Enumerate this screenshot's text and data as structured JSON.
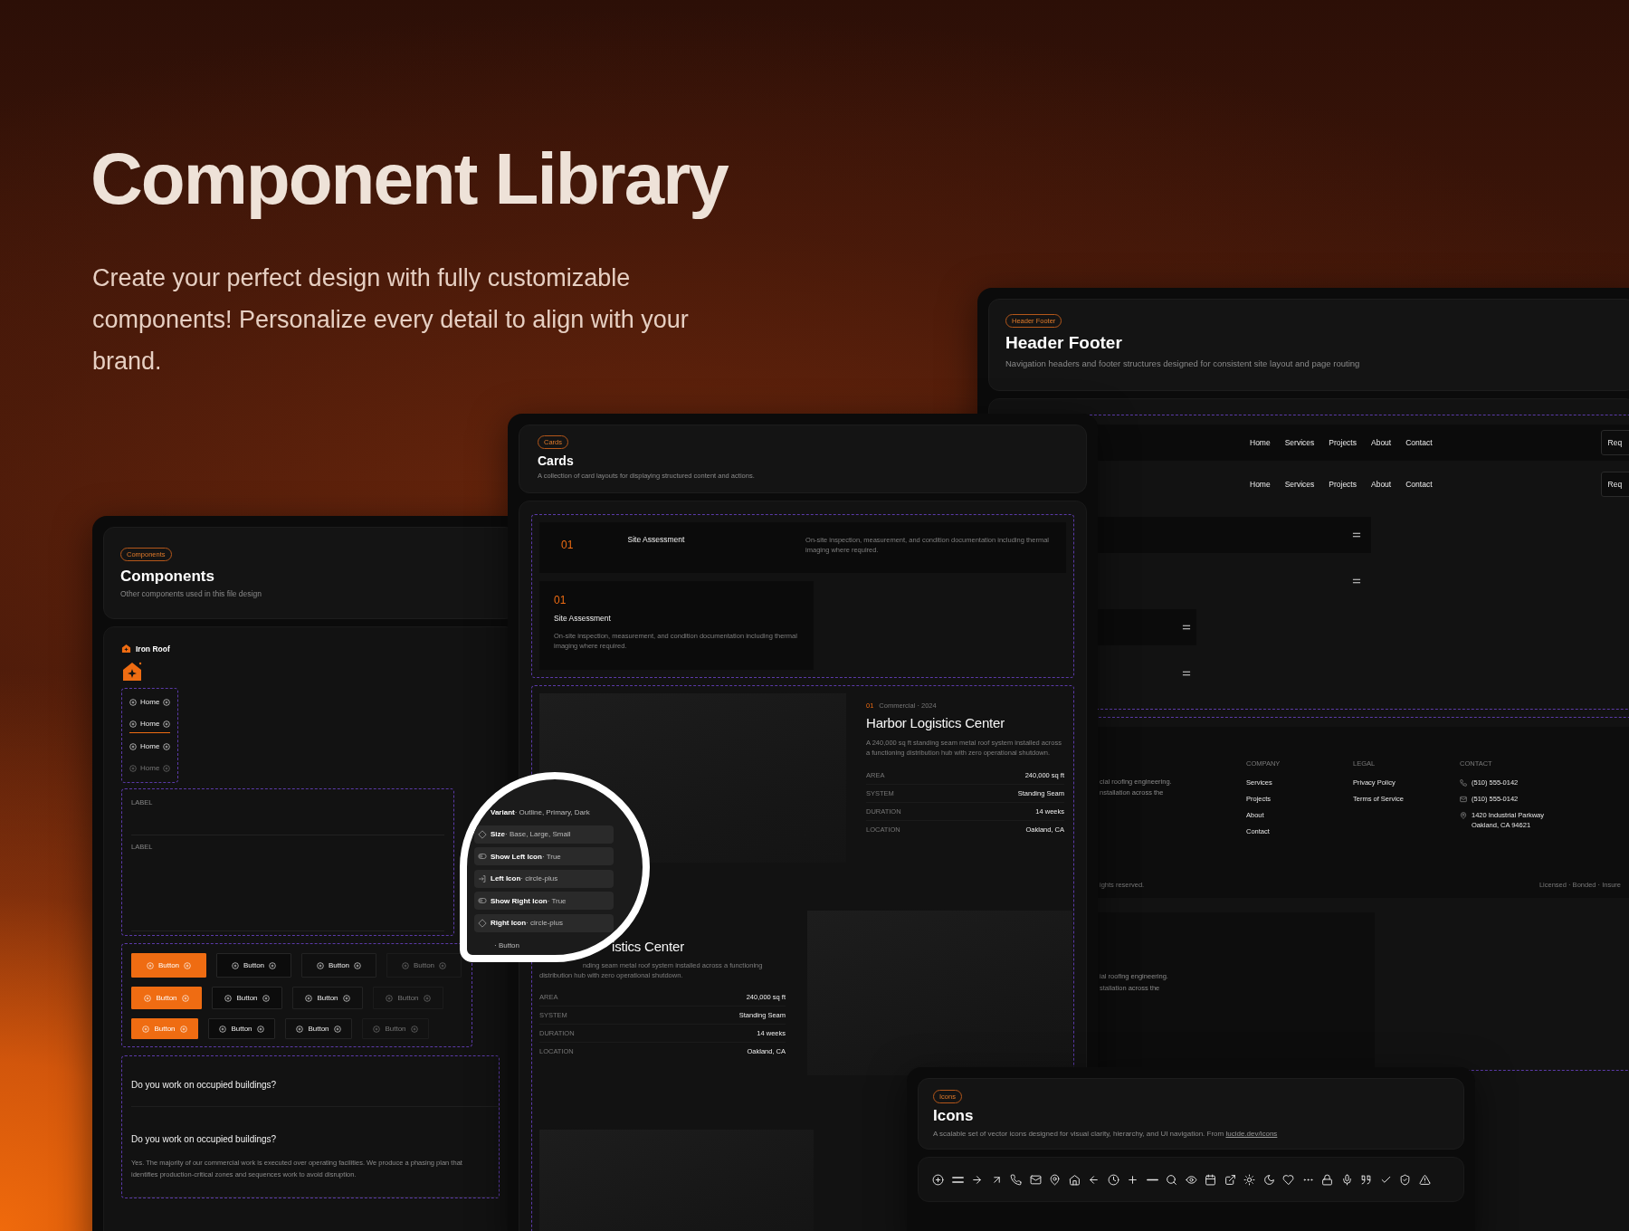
{
  "hero": {
    "title": "Component Library",
    "subtitle": "Create your perfect design with fully customizable components! Personalize every detail to align with your brand."
  },
  "components_panel": {
    "badge": "Components",
    "title": "Components",
    "description": "Other components used in this file design",
    "logo_name": "Iron Roof",
    "nav_items": [
      {
        "label": "Home",
        "selected": false,
        "disabled": false
      },
      {
        "label": "Home",
        "selected": true,
        "disabled": false
      },
      {
        "label": "Home",
        "selected": false,
        "disabled": false
      },
      {
        "label": "Home",
        "selected": false,
        "disabled": true
      }
    ],
    "fields": [
      {
        "label": "LABEL",
        "kind": "input"
      },
      {
        "label": "LABEL",
        "kind": "textarea"
      }
    ],
    "button_rows": [
      {
        "kind": "large",
        "buttons": [
          {
            "label": "Button",
            "kind": "primary"
          },
          {
            "label": "Button",
            "kind": "outline"
          },
          {
            "label": "Button",
            "kind": "dark"
          },
          {
            "label": "Button",
            "kind": "ghost"
          }
        ]
      },
      {
        "kind": "base",
        "buttons": [
          {
            "label": "Button",
            "kind": "primary"
          },
          {
            "label": "Button",
            "kind": "outline"
          },
          {
            "label": "Button",
            "kind": "dark"
          },
          {
            "label": "Button",
            "kind": "ghost"
          }
        ]
      },
      {
        "kind": "small",
        "buttons": [
          {
            "label": "Button",
            "kind": "primary"
          },
          {
            "label": "Button",
            "kind": "outline"
          },
          {
            "label": "Button",
            "kind": "dark"
          },
          {
            "label": "Button",
            "kind": "ghost"
          }
        ]
      }
    ],
    "faq": [
      {
        "question": "Do you work on occupied buildings?",
        "expanded": false
      },
      {
        "question": "Do you work on occupied buildings?",
        "expanded": true,
        "answer": "Yes. The majority of our commercial work is executed over operating facilities. We produce a phasing plan that identifies production-critical zones and sequences work to avoid disruption."
      }
    ]
  },
  "cards_panel": {
    "badge": "Cards",
    "title": "Cards",
    "description": "A collection of card layouts for displaying structured content and actions.",
    "service_cards": [
      {
        "kind": "horizontal",
        "number": "01",
        "title": "Site Assessment",
        "description": "On-site inspection, measurement, and condition documentation including thermal imaging where required."
      },
      {
        "kind": "vertical",
        "number": "01",
        "title": "Site Assessment",
        "description": "On-site inspection, measurement, and condition documentation including thermal imaging where required."
      }
    ],
    "project_cards": [
      {
        "kind": "image_left",
        "index": "01",
        "meta": "Commercial · 2024",
        "title": "Harbor Logistics Center",
        "description": "A 240,000 sq ft standing seam metal roof system installed across a functioning distribution hub with zero operational shutdown.",
        "specs": [
          {
            "label": "AREA",
            "value": "240,000 sq ft"
          },
          {
            "label": "SYSTEM",
            "value": "Standing Seam"
          },
          {
            "label": "DURATION",
            "value": "14 weeks"
          },
          {
            "label": "LOCATION",
            "value": "Oakland, CA"
          }
        ]
      },
      {
        "kind": "image_right",
        "title": "istics Center",
        "description_lines": [
          "nding seam metal roof system installed across a functioning",
          "distribution hub with zero operational shutdown."
        ],
        "specs": [
          {
            "label": "AREA",
            "value": "240,000 sq ft"
          },
          {
            "label": "SYSTEM",
            "value": "Standing Seam"
          },
          {
            "label": "DURATION",
            "value": "14 weeks"
          },
          {
            "label": "LOCATION",
            "value": "Oakland, CA"
          }
        ]
      },
      {
        "kind": "image_only"
      }
    ]
  },
  "properties_magnifier": {
    "rows": [
      {
        "label": "Variant",
        "value": "· Outline, Primary, Dark"
      },
      {
        "label": "Size",
        "value": "· Base, Large, Small",
        "kind": "variant"
      },
      {
        "label": "Show Left Icon",
        "value": "· True",
        "kind": "boolean"
      },
      {
        "label": "Left Icon",
        "value": "· circle-plus",
        "kind": "instance"
      },
      {
        "label": "Show Right Icon",
        "value": "· True",
        "kind": "boolean"
      },
      {
        "label": "Right Icon",
        "value": "· circle-plus",
        "kind": "variant"
      },
      {
        "value": "· Button"
      }
    ]
  },
  "header_footer_panel": {
    "badge": "Header Footer",
    "title": "Header Footer",
    "description": "Navigation headers and footer structures designed for consistent site layout and page routing",
    "nav_bars": [
      {
        "links": [
          "Home",
          "Services",
          "Projects",
          "About",
          "Contact"
        ],
        "cta": "Req"
      },
      {
        "links": [
          "Home",
          "Services",
          "Projects",
          "About",
          "Contact"
        ],
        "cta": "Req"
      }
    ],
    "footer": {
      "tagline_lines": [
        "cial roofing engineering.",
        "nstallation across the"
      ],
      "columns": [
        {
          "heading": "COMPANY",
          "links": [
            "Services",
            "Projects",
            "About",
            "Contact"
          ]
        },
        {
          "heading": "LEGAL",
          "links": [
            "Privacy Policy",
            "Terms of Service"
          ]
        }
      ],
      "contact": {
        "heading": "CONTACT",
        "items": [
          {
            "kind": "phone",
            "lines": [
              "(510) 555-0142"
            ]
          },
          {
            "kind": "email",
            "lines": [
              "(510) 555-0142"
            ]
          },
          {
            "kind": "address",
            "lines": [
              "1420 Industrial Parkway",
              "Oakland, CA 94621"
            ]
          }
        ]
      },
      "copyright": "ights reserved.",
      "legal_note": "Licensed · Bonded · Insure"
    },
    "mobile_footer": {
      "tagline_lines": [
        "ial roofing engineering.",
        "stallation across the"
      ]
    }
  },
  "icons_panel": {
    "badge": "Icons",
    "title": "Icons",
    "description": "A scalable set of vector icons designed for visual clarity, hierarchy, and UI navigation. From",
    "link": "lucide.dev/icons"
  }
}
